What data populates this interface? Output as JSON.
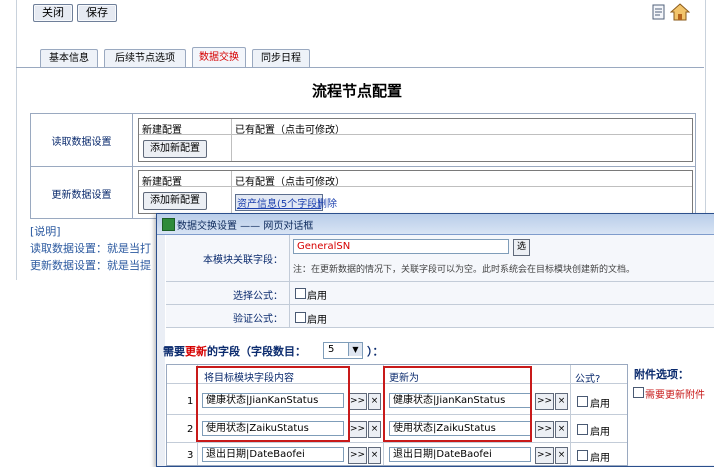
{
  "toolbar": {
    "close": "关闭",
    "save": "保存"
  },
  "tabs": [
    "基本信息",
    "后续节点选项",
    "数据交换",
    "同步日程"
  ],
  "page_title": "流程节点配置",
  "read_settings": {
    "label": "读取数据设置",
    "new_header": "新建配置",
    "existing_header": "已有配置（点击可修改）",
    "add_button": "添加新配置"
  },
  "update_settings": {
    "label": "更新数据设置",
    "new_header": "新建配置",
    "existing_header": "已有配置（点击可修改）",
    "add_button": "添加新配置",
    "existing_link": "资产信息(5个字段)",
    "delete_link": "删除"
  },
  "notes": {
    "title": "[说明]",
    "line1": "读取数据设置：就是当打",
    "line2": "更新数据设置：就是当提"
  },
  "dialog": {
    "title": "数据交换设置 —— 网页对话框",
    "key_field_label": "本模块关联字段：",
    "key_field_value": "GeneralSN",
    "key_field_button": "选",
    "key_field_hint": "注：在更新数据的情况下，关联字段可以为空。此时系统会在目标模块创建新的文档。",
    "select_formula_label": "选择公式：",
    "select_formula_enable": "启用",
    "verify_formula_label": "验证公式：",
    "verify_formula_enable": "启用",
    "section_prefix": "需要",
    "section_red": "更新",
    "section_suffix": "的字段（字段数目：",
    "section_end": "）：",
    "field_count": "5",
    "col_target": "将目标模块字段内容",
    "col_update": "更新为",
    "col_formula": "公式?",
    "rows": [
      {
        "num": "1",
        "target": "健康状态|JianKanStatus",
        "update": "健康状态|JianKanStatus",
        "enable": "启用"
      },
      {
        "num": "2",
        "target": "使用状态|ZaikuStatus",
        "update": "使用状态|ZaikuStatus",
        "enable": "启用"
      },
      {
        "num": "3",
        "target": "退出日期|DateBaofei",
        "update": "退出日期|DateBaofei",
        "enable": "启用"
      }
    ],
    "move_btn": ">>",
    "del_btn": "×",
    "attach_title": "附件选项：",
    "attach_option": "需要更新附件"
  }
}
